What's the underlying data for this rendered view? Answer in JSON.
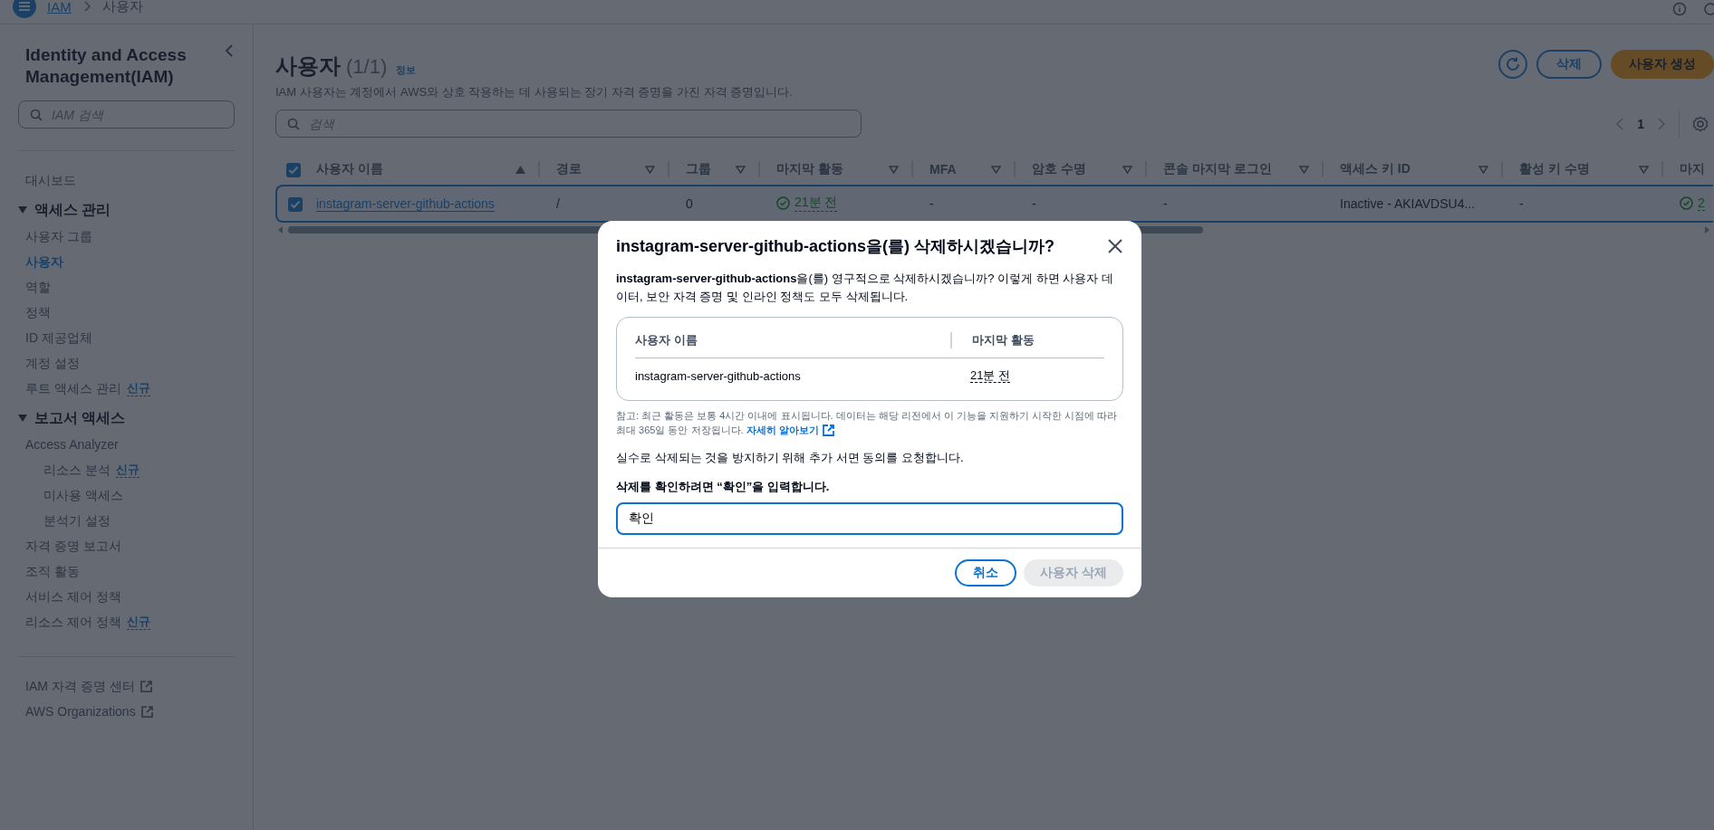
{
  "top_bar": {
    "breadcrumbs": [
      {
        "label": "IAM",
        "kind": "link"
      },
      {
        "label": "사용자",
        "kind": "current"
      }
    ]
  },
  "sidebar": {
    "title": "Identity and Access Management(IAM)",
    "search": {
      "placeholder": "IAM 검색"
    },
    "top_items": [
      {
        "label": "대시보드",
        "selected": false
      }
    ],
    "sections": [
      {
        "label": "액세스 관리",
        "expanded": true,
        "items": [
          {
            "label": "사용자 그룹",
            "selected": false
          },
          {
            "label": "사용자",
            "selected": true
          },
          {
            "label": "역할",
            "selected": false
          },
          {
            "label": "정책",
            "selected": false
          },
          {
            "label": "ID 제공업체",
            "selected": false
          },
          {
            "label": "계정 설정",
            "selected": false
          },
          {
            "label": "루트 액세스 관리",
            "selected": false,
            "badge": "신규"
          }
        ]
      },
      {
        "label": "보고서 액세스",
        "expanded": true,
        "items": [
          {
            "label": "Access Analyzer",
            "selected": false,
            "children": [
              {
                "label": "리소스 분석",
                "selected": false,
                "badge": "신규"
              },
              {
                "label": "미사용 액세스",
                "selected": false
              },
              {
                "label": "분석기 설정",
                "selected": false
              }
            ]
          },
          {
            "label": "자격 증명 보고서",
            "selected": false
          },
          {
            "label": "조직 활동",
            "selected": false
          },
          {
            "label": "서비스 제어 정책",
            "selected": false
          },
          {
            "label": "리소스 제어 정책",
            "selected": false,
            "badge": "신규"
          }
        ]
      }
    ],
    "external_links": [
      {
        "label": "IAM 자격 증명 센터"
      },
      {
        "label": "AWS Organizations"
      }
    ]
  },
  "page": {
    "title": "사용자",
    "count": "(1/1)",
    "info_link": "정보",
    "description": "IAM 사용자는 계정에서 AWS와 상호 작용하는 데 사용되는 장기 자격 증명을 가진 자격 증명입니다.",
    "buttons": [
      {
        "label": "삭제",
        "kind": "secondary"
      },
      {
        "label": "사용자 생성",
        "kind": "primary"
      }
    ],
    "search": {
      "placeholder": "검색"
    },
    "pagination": {
      "page": "1"
    }
  },
  "table": {
    "all_selected": true,
    "columns": [
      {
        "label": "사용자 이름",
        "sorted": true
      },
      {
        "label": "경로",
        "sorted": false
      },
      {
        "label": "그룹",
        "sorted": false
      },
      {
        "label": "마지막 활동",
        "sorted": false
      },
      {
        "label": "MFA",
        "sorted": false
      },
      {
        "label": "암호 수명",
        "sorted": false
      },
      {
        "label": "콘솔 마지막 로그인",
        "sorted": false
      },
      {
        "label": "액세스 키 ID",
        "sorted": false
      },
      {
        "label": "활성 키 수명",
        "sorted": false
      },
      {
        "label": "마지"
      }
    ],
    "rows": [
      {
        "selected": true,
        "cells": [
          {
            "text": "instagram-server-github-actions",
            "kind": "link"
          },
          {
            "text": "/",
            "kind": "text"
          },
          {
            "text": "0",
            "kind": "text"
          },
          {
            "text": "21분 전",
            "kind": "status"
          },
          {
            "text": "-",
            "kind": "text"
          },
          {
            "text": "-",
            "kind": "text"
          },
          {
            "text": "-",
            "kind": "text"
          },
          {
            "text": "Inactive - AKIAVDSU4...",
            "kind": "text"
          },
          {
            "text": "-",
            "kind": "text"
          },
          {
            "text": "2",
            "kind": "status"
          }
        ]
      }
    ]
  },
  "dialog": {
    "title": "instagram-server-github-actions을(를) 삭제하시겠습니까?",
    "message": "**instagram-server-github-actions**을(를) 영구적으로 삭제하시겠습니까? 이렇게 하면 사용자 데이터, 보안 자격 증명 및 인라인 정책도 모두 삭제됩니다.",
    "table": {
      "columns": [
        "사용자 이름",
        "마지막 활동"
      ],
      "rows": [
        [
          "instagram-server-github-actions",
          "21분 전"
        ]
      ]
    },
    "note": "참고: 최근 활동은 보통 4시간 이내에 표시됩니다. 데이터는 해당 리전에서 이 기능을 지원하기 시작한 시점에 따라 최대 365일 동안 저장됩니다.",
    "note_link": "자세히 알아보기",
    "consent": "실수로 삭제되는 것을 방지하기 위해 추가 서면 동의를 요청합니다.",
    "confirm_label": "삭제를 확인하려면 “확인”을 입력합니다.",
    "confirm_value": "확인",
    "buttons": [
      {
        "label": "취소",
        "kind": "secondary",
        "disabled": false
      },
      {
        "label": "사용자 삭제",
        "kind": "primary",
        "disabled": true
      }
    ]
  }
}
